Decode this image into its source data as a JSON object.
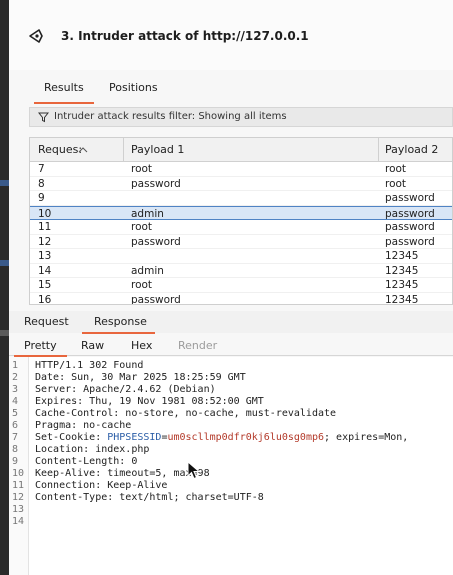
{
  "window": {
    "title": "3. Intruder attack of http://127.0.0.1",
    "icon": "intruder-target-icon"
  },
  "top_tabs": [
    {
      "label": "Results",
      "active": true
    },
    {
      "label": "Positions",
      "active": false
    }
  ],
  "filter": {
    "icon": "filter-icon",
    "text": "Intruder attack results filter: Showing all items"
  },
  "results_table": {
    "columns": [
      "Reques:",
      "Payload 1",
      "Payload 2"
    ],
    "sort_icon": "sort-ascending-icon",
    "rows": [
      {
        "request": "7",
        "payload1": "root",
        "payload2": "root"
      },
      {
        "request": "8",
        "payload1": "password",
        "payload2": "root"
      },
      {
        "request": "9",
        "payload1": "",
        "payload2": "password"
      },
      {
        "request": "10",
        "payload1": "admin",
        "payload2": "password",
        "selected": true
      },
      {
        "request": "11",
        "payload1": "root",
        "payload2": "password"
      },
      {
        "request": "12",
        "payload1": "password",
        "payload2": "password"
      },
      {
        "request": "13",
        "payload1": "",
        "payload2": "12345"
      },
      {
        "request": "14",
        "payload1": "admin",
        "payload2": "12345"
      },
      {
        "request": "15",
        "payload1": "root",
        "payload2": "12345"
      },
      {
        "request": "16",
        "payload1": "password",
        "payload2": "12345"
      }
    ]
  },
  "reqres_tabs": [
    {
      "label": "Request",
      "active": false
    },
    {
      "label": "Response",
      "active": true
    }
  ],
  "view_tabs": [
    {
      "label": "Pretty",
      "active": true,
      "disabled": false
    },
    {
      "label": "Raw",
      "active": false,
      "disabled": false
    },
    {
      "label": "Hex",
      "active": false,
      "disabled": false
    },
    {
      "label": "Render",
      "active": false,
      "disabled": true
    }
  ],
  "response_lines": [
    {
      "n": "1",
      "text": "HTTP/1.1 302 Found"
    },
    {
      "n": "2",
      "text": "Date: Sun, 30 Mar 2025 18:25:59 GMT"
    },
    {
      "n": "3",
      "text": "Server: Apache/2.4.62 (Debian)"
    },
    {
      "n": "4",
      "text": "Expires: Thu, 19 Nov 1981 08:52:00 GMT"
    },
    {
      "n": "5",
      "text": "Cache-Control: no-store, no-cache, must-revalidate"
    },
    {
      "n": "6",
      "text": "Pragma: no-cache"
    },
    {
      "n": "7",
      "text": "Set-Cookie: PHPSESSID=um0scllmp0dfr0kj6lu0sg0mp6; expires=Mon,"
    },
    {
      "n": "8",
      "text": "Location: index.php"
    },
    {
      "n": "9",
      "text": "Content-Length: 0"
    },
    {
      "n": "10",
      "text": "Keep-Alive: timeout=5, max=98"
    },
    {
      "n": "11",
      "text": "Connection: Keep-Alive"
    },
    {
      "n": "12",
      "text": "Content-Type: text/html; charset=UTF-8"
    },
    {
      "n": "13",
      "text": ""
    },
    {
      "n": "14",
      "text": ""
    }
  ],
  "cookie": {
    "prefix": "Set-Cookie: ",
    "name": "PHPSESSID",
    "eq": "=",
    "value": "um0scllmp0dfr0kj6lu0sg0mp6",
    "suffix": "; expires=Mon,"
  },
  "colors": {
    "accent": "#e8663d",
    "selection": "#d9e6f6",
    "cookie_name": "#2b5ea7",
    "cookie_value": "#b33a2a"
  }
}
